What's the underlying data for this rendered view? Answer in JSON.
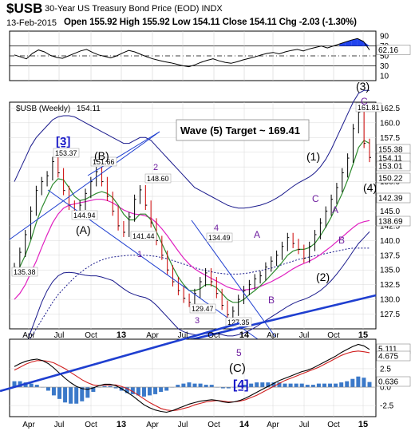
{
  "header": {
    "title": "$USB",
    "subtitle": "30-Year US Treasury Bond Price (EOD)",
    "exchange": "INDX",
    "date": "13-Feb-2015",
    "open_label": "Open",
    "open": "155.92",
    "high_label": "High",
    "high": "155.92",
    "low_label": "Low",
    "low": "154.11",
    "close_label": "Close",
    "close": "154.11",
    "chg_label": "Chg",
    "chg": "-2.03 (-1.30%)"
  },
  "colors": {
    "price_bar": "#000000",
    "ma_fast": "#2e8b2e",
    "ma_pink": "#e020c0",
    "band": "#1a1a8c",
    "trendline": "#1f3fd0",
    "rsi_line": "#000000",
    "rsi_fill": "#2244ee",
    "macd_line": "#000000",
    "macd_signal": "#d02020",
    "histogram": "#3b79c9",
    "label_purple": "#7020a0",
    "label_blue": "#1818c8"
  },
  "x_labels": [
    "Apr",
    "Jul",
    "Oct",
    "13",
    "Apr",
    "Jul",
    "Oct",
    "14",
    "Apr",
    "Jul",
    "Oct",
    "15"
  ],
  "chart_data": [
    {
      "type": "line",
      "name": "RSI",
      "yticks": [
        90,
        70,
        50,
        30,
        10
      ],
      "levels": [
        70,
        50,
        30
      ],
      "last_value": "62.16",
      "ylim": [
        0,
        100
      ],
      "values": [
        52,
        48,
        44,
        55,
        62,
        58,
        51,
        47,
        45,
        50,
        55,
        60,
        63,
        57,
        52,
        49,
        46,
        50,
        56,
        61,
        58,
        53,
        48,
        44,
        41,
        38,
        36,
        33,
        30,
        28,
        32,
        37,
        41,
        44,
        40,
        37,
        35,
        38,
        42,
        45,
        48,
        52,
        55,
        57,
        54,
        58,
        61,
        63,
        60,
        64,
        67,
        70,
        66,
        70,
        74,
        78,
        82,
        85,
        79,
        62
      ]
    },
    {
      "type": "line",
      "name": "$USB (Weekly)",
      "header_value": "154.11",
      "ylim": [
        125,
        163.5
      ],
      "yticks": [
        127.5,
        130.0,
        132.5,
        135.0,
        137.5,
        140.0,
        142.5,
        145.0,
        147.5,
        150.0,
        152.5,
        155.0,
        157.5,
        160.0,
        162.5
      ],
      "last_value_labels": [
        "155.38",
        "154.11",
        "153.01",
        "150.22",
        "142.39",
        "138.69"
      ],
      "close": [
        135.4,
        138,
        141,
        145,
        148.5,
        150,
        151,
        153.4,
        151.5,
        148.5,
        146,
        144.9,
        146,
        148,
        150,
        151.7,
        150,
        147.5,
        145,
        142.5,
        141.4,
        144,
        147,
        148.6,
        146,
        143,
        140,
        137.5,
        135,
        133,
        131.5,
        130.2,
        129.5,
        131,
        133,
        134.5,
        133,
        131,
        129,
        127.4,
        128,
        130,
        131.5,
        132.5,
        133.5,
        134,
        135.5,
        136.5,
        137.5,
        139,
        140.5,
        139.5,
        138.5,
        137,
        139,
        141,
        143,
        145,
        147,
        149,
        151.5,
        154,
        159,
        161.8,
        156.5,
        154.11
      ],
      "ma_fast": [
        134,
        135.5,
        137.5,
        140,
        143,
        145.5,
        147.5,
        149.5,
        150.5,
        150.3,
        149,
        147.5,
        146.8,
        147,
        147.5,
        148,
        148.3,
        148,
        147.3,
        146,
        144.5,
        143.5,
        143.5,
        144.5,
        144.5,
        143.5,
        141.5,
        139.5,
        137.5,
        135.5,
        133.8,
        132.5,
        131.5,
        131.5,
        131.8,
        132.5,
        132.5,
        132,
        131,
        130,
        129.5,
        129.5,
        130,
        130.8,
        131.5,
        132.3,
        133.2,
        134.2,
        135.2,
        136.3,
        137.5,
        138.2,
        138.5,
        138.5,
        138.8,
        139.5,
        140.8,
        142.3,
        144,
        146,
        148,
        150.3,
        153,
        155.8,
        157,
        156.5
      ],
      "ma_pink": [
        130,
        131,
        132.5,
        134.5,
        136.5,
        138.8,
        141,
        143,
        144.5,
        145.5,
        146,
        146.2,
        146.4,
        146.6,
        146.8,
        147,
        147,
        146.8,
        146.4,
        145.8,
        145.2,
        144.8,
        144.5,
        144.4,
        144.2,
        143.8,
        143,
        142,
        140.8,
        139.5,
        138.2,
        137,
        136,
        135.2,
        134.6,
        134.1,
        133.6,
        133.1,
        132.6,
        132.1,
        131.8,
        131.6,
        131.6,
        131.7,
        131.9,
        132.2,
        132.6,
        133,
        133.5,
        134,
        134.6,
        135.2,
        135.7,
        136.1,
        136.5,
        137,
        137.6,
        138.3,
        139,
        139.8,
        140.6,
        141.4,
        142.2,
        142.9,
        143.2,
        143.4
      ],
      "band_upper": [
        150,
        152,
        154,
        156,
        157.5,
        158.5,
        159.5,
        160.5,
        161,
        161.2,
        161.2,
        161,
        160.5,
        160,
        159.5,
        159,
        158.5,
        158,
        157.5,
        157,
        156.5,
        156.5,
        157,
        157.5,
        157.5,
        157,
        156,
        155,
        154,
        153,
        152,
        151,
        150,
        149,
        148.5,
        148,
        147.5,
        147,
        146.5,
        146,
        145.7,
        145.5,
        145.5,
        145.6,
        145.8,
        146,
        146.3,
        146.7,
        147.2,
        147.8,
        148.5,
        149.2,
        149.8,
        150.3,
        150.8,
        151.5,
        152.5,
        153.8,
        155.5,
        157.5,
        159.5,
        161.5,
        163.5,
        165,
        165.5,
        165.5
      ],
      "band_lower": [
        118,
        120,
        122,
        124.5,
        127,
        129.5,
        131.5,
        133,
        134,
        134.5,
        134.6,
        134.5,
        134.3,
        134.1,
        134,
        134,
        133.8,
        133.5,
        133.2,
        132.5,
        131.8,
        131.2,
        130.8,
        130.5,
        130.3,
        129.8,
        129,
        128,
        127,
        126,
        125,
        124.5,
        124.2,
        124,
        124,
        124.2,
        124.3,
        124.2,
        124,
        123.8,
        123.8,
        124,
        124.3,
        124.7,
        125.2,
        125.8,
        126.4,
        127,
        127.6,
        128.2,
        128.8,
        129.3,
        129.7,
        130,
        130.4,
        130.9,
        131.5,
        132.3,
        133.2,
        134.3,
        135.5,
        136.8,
        138.2,
        139.5,
        140.5,
        141.5
      ],
      "dotted_ma": [
        120,
        121,
        122,
        123.5,
        125,
        126.5,
        128,
        129.5,
        130.8,
        131.8,
        132.8,
        133.7,
        134.5,
        135.2,
        135.8,
        136.3,
        136.7,
        137,
        137.2,
        137.3,
        137.4,
        137.5,
        137.5,
        137.5,
        137.5,
        137.4,
        137.3,
        137.1,
        136.9,
        136.6,
        136.3,
        136,
        135.7,
        135.4,
        135.1,
        134.9,
        134.7,
        134.5,
        134.4,
        134.3,
        134.3,
        134.3,
        134.4,
        134.5,
        134.7,
        134.9,
        135.1,
        135.3,
        135.6,
        135.9,
        136.2,
        136.5,
        136.8,
        137,
        137.2,
        137.4,
        137.6,
        137.8,
        138,
        138.2,
        138.4,
        138.6,
        138.7,
        138.7,
        138.7,
        138.7
      ],
      "peak_labels": [
        "153.37",
        "151.66",
        "148.60",
        "144.94",
        "141.44",
        "134.49",
        "135.38",
        "129.47",
        "127.35",
        "161.81"
      ],
      "wave_labels": [
        "[3]",
        "(B)",
        "(A)",
        "2",
        "1",
        "4",
        "3",
        "A",
        "B",
        "C",
        "(1)",
        "(2)",
        "A",
        "B",
        "C",
        "(3)",
        "(4)",
        "5",
        "(C)",
        "[4]"
      ],
      "annotation": "Wave (5) Target ~ 169.41"
    },
    {
      "type": "line",
      "name": "MACD",
      "ylim": [
        -4,
        6.5
      ],
      "yticks": [
        2.5,
        0.0,
        -2.5
      ],
      "last_value_labels": [
        "5.111",
        "4.675",
        "0.636"
      ],
      "macd": [
        2.8,
        3.2,
        3.5,
        3.7,
        3.8,
        3.6,
        3.2,
        2.6,
        1.9,
        1.2,
        0.6,
        0.1,
        -0.2,
        -0.3,
        -0.1,
        0.2,
        0.4,
        0.4,
        0.2,
        -0.2,
        -0.7,
        -1.2,
        -1.8,
        -2.4,
        -2.8,
        -3.1,
        -3.3,
        -3.4,
        -3.2,
        -2.9,
        -2.6,
        -2.3,
        -2.1,
        -1.9,
        -1.8,
        -1.7,
        -1.8,
        -2,
        -2.1,
        -2,
        -1.8,
        -1.5,
        -1.1,
        -0.7,
        -0.3,
        0.1,
        0.5,
        0.9,
        1.2,
        1.5,
        1.8,
        2.1,
        2.3,
        2.6,
        3,
        3.4,
        3.8,
        4.2,
        4.7,
        5.1,
        5.5,
        5.8,
        5.6,
        5.111
      ],
      "signal": [
        2.3,
        2.7,
        3.1,
        3.4,
        3.6,
        3.6,
        3.5,
        3.3,
        2.9,
        2.5,
        2,
        1.5,
        1,
        0.6,
        0.3,
        0.2,
        0.3,
        0.3,
        0.3,
        0.1,
        -0.2,
        -0.6,
        -1.1,
        -1.6,
        -2.1,
        -2.5,
        -2.9,
        -3.1,
        -3.2,
        -3.1,
        -2.9,
        -2.7,
        -2.4,
        -2.2,
        -2,
        -1.9,
        -1.8,
        -1.9,
        -2,
        -2,
        -1.9,
        -1.7,
        -1.4,
        -1.1,
        -0.7,
        -0.3,
        0.1,
        0.5,
        0.9,
        1.2,
        1.5,
        1.8,
        2.1,
        2.4,
        2.7,
        3.1,
        3.5,
        3.9,
        4.3,
        4.6,
        4.8,
        4.9,
        4.8,
        4.675
      ]
    }
  ]
}
